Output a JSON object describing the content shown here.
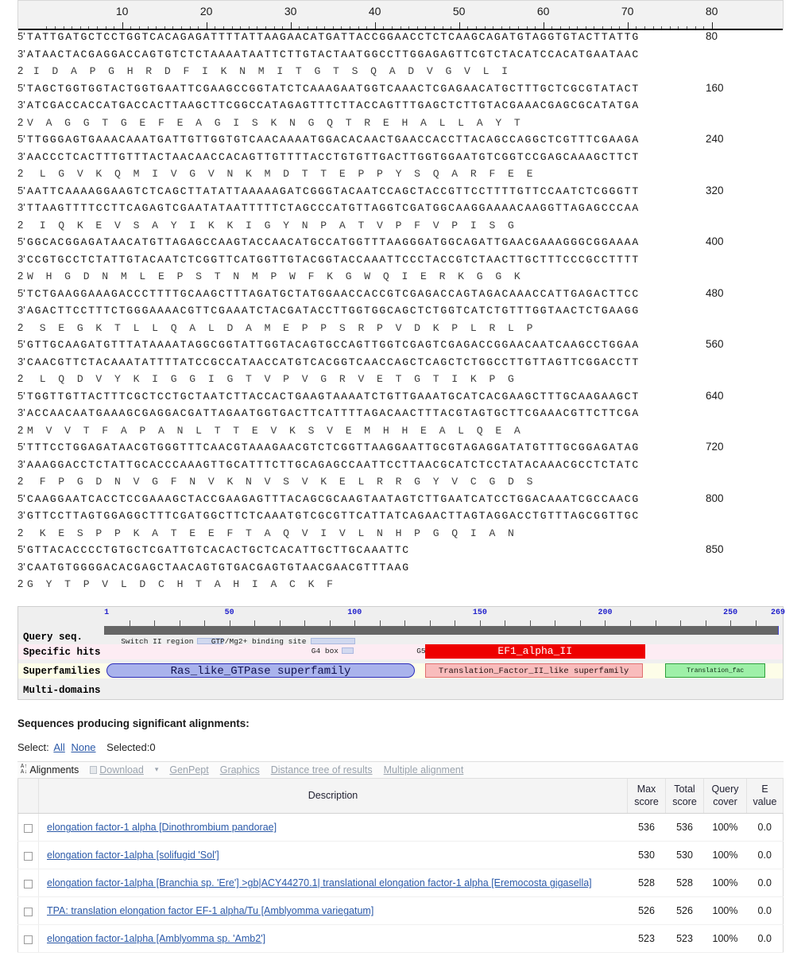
{
  "sequence_viewer": {
    "ruler_ticks": [
      10,
      20,
      30,
      40,
      50,
      60,
      70,
      80
    ],
    "blocks": [
      {
        "plus": "TATTGATGCTCCTGGTCACAGAGATTTTATTAAGAACATGATTACCGGAACCTCTCAAGCAGATGTAGGTGTACTTATTG",
        "minus": "ATAACTACGAGGACCAGTGTCTCTAAAATAATTCTTGTACTAATGGCCTTGGAGAGTTCGTCTACATCCACATGAATAAC",
        "protein": " I  D  A  P  G  H  R  D  F  I  K  N  M  I  T  G  T  S  Q  A  D  V  G  V  L  I ",
        "end": "80"
      },
      {
        "plus": "TAGCTGGTGGTACTGGTGAATTCGAAGCCGGTATCTCAAAGAATGGTCAAACTCGAGAACATGCTTTGCTCGCGTATACT",
        "minus": "ATCGACCACCATGACCACTTAAGCTTCGGCCATAGAGTTTCTTACCAGTTTGAGCTCTTGTACGAAACGAGCGCATATGA",
        "protein": "V  A  G  G  T  G  E  F  E  A  G  I  S  K  N  G  Q  T  R  E  H  A  L  L  A  Y  T",
        "end": "160"
      },
      {
        "plus": "TTGGGAGTGAAACAAATGATTGTTGGTGTCAACAAAATGGACACAACTGAACCACCTTACAGCCAGGCTCGTTTCGAAGA",
        "minus": "AACCCTCACTTTGTTTACTAACAACCACAGTTGTTTTACCTGTGTTGACTTGGTGGAATGTCGGTCCGAGCAAAGCTTCT",
        "protein": "  L  G  V  K  Q  M  I  V  G  V  N  K  M  D  T  T  E  P  P  Y  S  Q  A  R  F  E  E",
        "end": "240"
      },
      {
        "plus": "AATTCAAAAGGAAGTCTCAGCTTATATTAAAAAGATCGGGTACAATCCAGCTACCGTTCCTTTTGTTCCAATCTCGGGTT",
        "minus": "TTAAGTTTTCCTTCAGAGTCGAATATAATTTTTCTAGCCCATGTTAGGTCGATGGCAAGGAAAACAAGGTTAGAGCCCAA",
        "protein": "  I  Q  K  E  V  S  A  Y  I  K  K  I  G  Y  N  P  A  T  V  P  F  V  P  I  S  G ",
        "end": "320"
      },
      {
        "plus": "GGCACGGAGATAACATGTTAGAGCCAAGTACCAACATGCCATGGTTTAAGGGATGGCAGATTGAACGAAAGGGCGGAAAA",
        "minus": "CCGTGCCTCTATTGTACAATCTCGGTTCATGGTTGTACGGTACCAAATTCCCTACCGTCTAACTTGCTTTCCCGCCTTTT",
        "protein": "W  H  G  D  N  M  L  E  P  S  T  N  M  P  W  F  K  G  W  Q  I  E  R  K  G  G  K",
        "end": "400"
      },
      {
        "plus": "TCTGAAGGAAAGACCCTTTTGCAAGCTTTAGATGCTATGGAACCACCGTCGAGACCAGTAGACAAACCATTGAGACTTCC",
        "minus": "AGACTTCCTTTCTGGGAAAACGTTCGAAATCTACGATACCTTGGTGGCAGCTCTGGTCATCTGTTTGGTAACTCTGAAGG",
        "protein": "  S  E  G  K  T  L  L  Q  A  L  D  A  M  E  P  P  S  R  P  V  D  K  P  L  R  L  P",
        "end": "480"
      },
      {
        "plus": "GTTGCAAGATGTTTATAAAATAGGCGGTATTGGTACAGTGCCAGTTGGTCGAGTCGAGACCGGAACAATCAAGCCTGGAA",
        "minus": "CAACGTTCTACAAATATTTTATCCGCCATAACCATGTCACGGTCAACCAGCTCAGCTCTGGCCTTGTTAGTTCGGACCTT",
        "protein": "  L  Q  D  V  Y  K  I  G  G  I  G  T  V  P  V  G  R  V  E  T  G  T  I  K  P  G ",
        "end": "560"
      },
      {
        "plus": "TGGTTGTTACTTTCGCTCCTGCTAATCTTACCACTGAAGTAAAATCTGTTGAAATGCATCACGAAGCTTTGCAAGAAGCT",
        "minus": "ACCAACAATGAAAGCGAGGACGATTAGAATGGTGACTTCATTTTAGACAACTTTACGTAGTGCTTCGAAACGTTCTTCGA",
        "protein": "M  V  V  T  F  A  P  A  N  L  T  T  E  V  K  S  V  E  M  H  H  E  A  L  Q  E  A",
        "end": "640"
      },
      {
        "plus": "TTTCCTGGAGATAACGTGGGTTTCAACGTAAAGAACGTCTCGGTTAAGGAATTGCGTAGAGGATATGTTTGCGGAGATAG",
        "minus": "AAAGGACCTCTATTGCACCCAAAGTTGCATTTCTTGCAGAGCCAATTCCTTAACGCATCTCCTATACAAACGCCTCTATC",
        "protein": "  F  P  G  D  N  V  G  F  N  V  K  N  V  S  V  K  E  L  R  R  G  Y  V  C  G  D  S",
        "end": "720"
      },
      {
        "plus": "CAAGGAATCACCTCCGAAAGCTACCGAAGAGTTTACAGCGCAAGTAATAGTCTTGAATCATCCTGGACAAATCGCCAACG",
        "minus": "GTTCCTTAGTGGAGGCTTTCGATGGCTTCTCAAATGTCGCGTTCATTATCAGAACTTAGTAGGACCTGTTTAGCGGTTGC",
        "protein": "  K  E  S  P  P  K  A  T  E  E  F  T  A  Q  V  I  V  L  N  H  P  G  Q  I  A  N ",
        "end": "800"
      },
      {
        "plus": "GTTACACCCCTGTGCTCGATTGTCACACTGCTCACATTGCTTGCAAATTC",
        "minus": "CAATGTGGGGACACGAGCTAACAGTGTGACGAGTGTAACGAACGTTTAAG",
        "protein": "G  Y  T  P  V  L  D  C  H  T  A  H  I  A  C  K  F",
        "end": "850"
      }
    ],
    "strand_labels": {
      "plus": "5'",
      "minus": "3'",
      "frame": "2"
    }
  },
  "cdd_graphic": {
    "row_labels": {
      "query": "Query seq.",
      "specific_hits": "Specific hits",
      "superfamilies": "Superfamilies",
      "multi_domains": "Multi-domains"
    },
    "query_length": 269,
    "ruler_marks": [
      {
        "label": "1",
        "pos": 1
      },
      {
        "label": "50",
        "pos": 50
      },
      {
        "label": "100",
        "pos": 100
      },
      {
        "label": "150",
        "pos": 150
      },
      {
        "label": "200",
        "pos": 200
      },
      {
        "label": "250",
        "pos": 250
      },
      {
        "label": "269",
        "pos": 269
      }
    ],
    "features": [
      {
        "label": "Switch II region",
        "start": 8,
        "end": 38,
        "row": 0
      },
      {
        "label": "GTP/Mg2+ binding site",
        "start": 44,
        "end": 95,
        "row": 0
      },
      {
        "label": "G4 box",
        "start": 84,
        "end": 98,
        "row": 1
      },
      {
        "label": "G5 box",
        "start": 126,
        "end": 140,
        "row": 1
      }
    ],
    "specific_hits": [
      {
        "label": "EF1_alpha_II",
        "start": 128,
        "end": 216,
        "color": "red"
      }
    ],
    "superfamilies": [
      {
        "label": "Ras_like_GTPase superfamily",
        "start": 1,
        "end": 124,
        "color": "blue"
      },
      {
        "label": "Translation_Factor_II_like superfamily",
        "start": 128,
        "end": 215,
        "color": "pink"
      },
      {
        "label": "Translation_fac",
        "start": 224,
        "end": 264,
        "color": "green"
      }
    ]
  },
  "results": {
    "heading": "Sequences producing significant alignments:",
    "select_label": "Select:",
    "select_all": "All",
    "select_none": "None",
    "selected_text": "Selected:0",
    "toolbar": {
      "alignments": "Alignments",
      "download": "Download",
      "genpept": "GenPept",
      "graphics": "Graphics",
      "distance_tree": "Distance tree of results",
      "multiple_alignment": "Multiple alignment"
    },
    "columns": {
      "description": "Description",
      "max_score": "Max\nscore",
      "max_score_l1": "Max",
      "max_score_l2": "score",
      "total_score_l1": "Total",
      "total_score_l2": "score",
      "query_cover_l1": "Query",
      "query_cover_l2": "cover",
      "e_value_l1": "E",
      "e_value_l2": "value"
    },
    "rows": [
      {
        "description": "elongation factor-1 alpha [Dinothrombium pandorae]",
        "max_score": "536",
        "total_score": "536",
        "query_cover": "100%",
        "e_value": "0.0"
      },
      {
        "description": "elongation factor-1alpha [solifugid 'Sol']",
        "max_score": "530",
        "total_score": "530",
        "query_cover": "100%",
        "e_value": "0.0"
      },
      {
        "description": "elongation factor-1alpha [Branchia sp. 'Ere'] >gb|ACY44270.1| translational elongation factor-1 alpha [Eremocosta gigasella]",
        "max_score": "528",
        "total_score": "528",
        "query_cover": "100%",
        "e_value": "0.0"
      },
      {
        "description": "TPA: translation elongation factor EF-1 alpha/Tu [Amblyomma variegatum]",
        "max_score": "526",
        "total_score": "526",
        "query_cover": "100%",
        "e_value": "0.0"
      },
      {
        "description": "elongation factor-1alpha [Amblyomma sp. 'Amb2']",
        "max_score": "523",
        "total_score": "523",
        "query_cover": "100%",
        "e_value": "0.0"
      }
    ]
  },
  "colors": {
    "link": "#2b59a8",
    "specific_hit": "#ee0000",
    "superfamily_blue": "#a9b3ec",
    "superfamily_pink": "#f9bcbc",
    "superfamily_green": "#9ef0a8",
    "query_bar": "#666666"
  }
}
